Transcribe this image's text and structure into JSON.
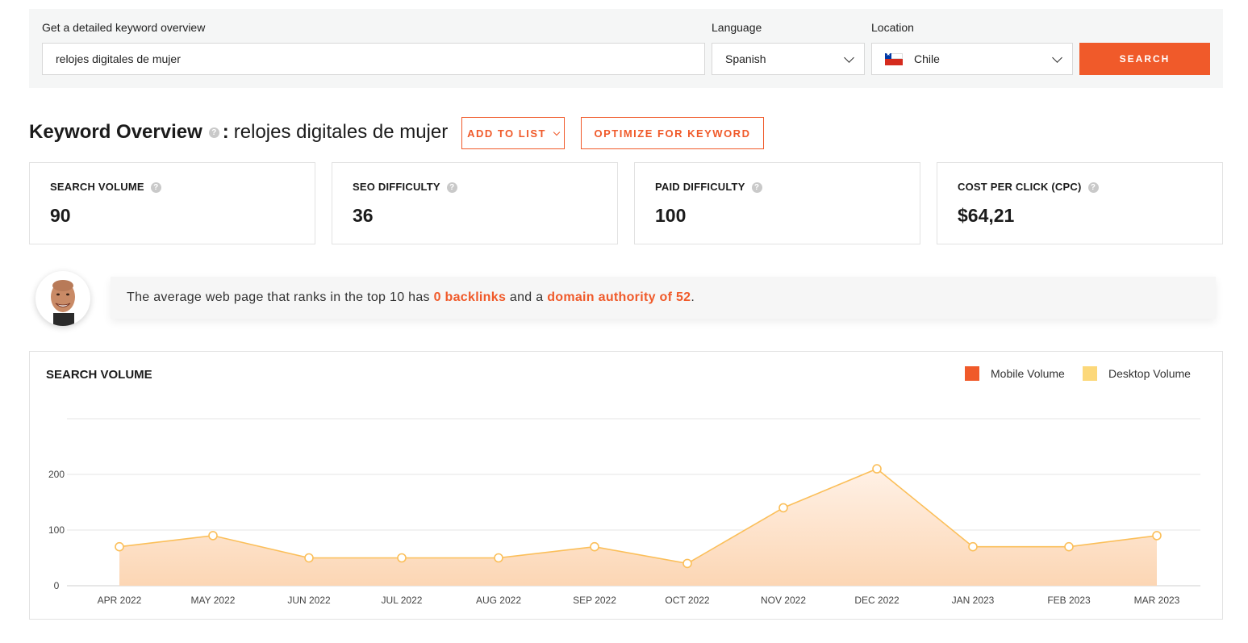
{
  "search": {
    "keyword_label": "Get a detailed keyword overview",
    "keyword_value": "relojes digitales de mujer",
    "language_label": "Language",
    "language_value": "Spanish",
    "location_label": "Location",
    "location_value": "Chile",
    "search_button": "SEARCH"
  },
  "overview": {
    "title": "Keyword Overview",
    "colon": ":",
    "keyword": "relojes digitales de mujer",
    "add_to_list": "ADD TO LIST",
    "optimize": "OPTIMIZE FOR KEYWORD"
  },
  "metrics": [
    {
      "label": "SEARCH VOLUME",
      "value": "90"
    },
    {
      "label": "SEO DIFFICULTY",
      "value": "36"
    },
    {
      "label": "PAID DIFFICULTY",
      "value": "100"
    },
    {
      "label": "COST PER CLICK (CPC)",
      "value": "$64,21"
    }
  ],
  "tip": {
    "prefix": "The average web page that ranks in the top 10 has ",
    "backlinks": "0 backlinks",
    "middle": " and a ",
    "authority": "domain authority of 52",
    "suffix": "."
  },
  "icons": {
    "help": "question-icon",
    "chevron": "chevron-down-icon",
    "flag": "chile-flag-icon",
    "avatar": "author-avatar"
  },
  "colors": {
    "accent": "#f05a2a",
    "mobile": "#f05a2a",
    "desktop": "#fcd87a",
    "line": "#fbbf5a",
    "area": "#fde0c6"
  },
  "chart_data": {
    "type": "area",
    "title": "SEARCH VOLUME",
    "categories": [
      "APR 2022",
      "MAY 2022",
      "JUN 2022",
      "JUL 2022",
      "AUG 2022",
      "SEP 2022",
      "OCT 2022",
      "NOV 2022",
      "DEC 2022",
      "JAN 2023",
      "FEB 2023",
      "MAR 2023"
    ],
    "series": [
      {
        "name": "Mobile Volume",
        "values": [
          null,
          null,
          null,
          null,
          null,
          null,
          null,
          null,
          null,
          null,
          null,
          null
        ]
      },
      {
        "name": "Desktop Volume",
        "values": [
          70,
          90,
          50,
          50,
          50,
          70,
          40,
          140,
          210,
          70,
          70,
          90
        ]
      }
    ],
    "yticks": [
      "0",
      "100",
      "200"
    ],
    "ylim": [
      0,
      300
    ],
    "legend": "top-right",
    "grid": true
  }
}
